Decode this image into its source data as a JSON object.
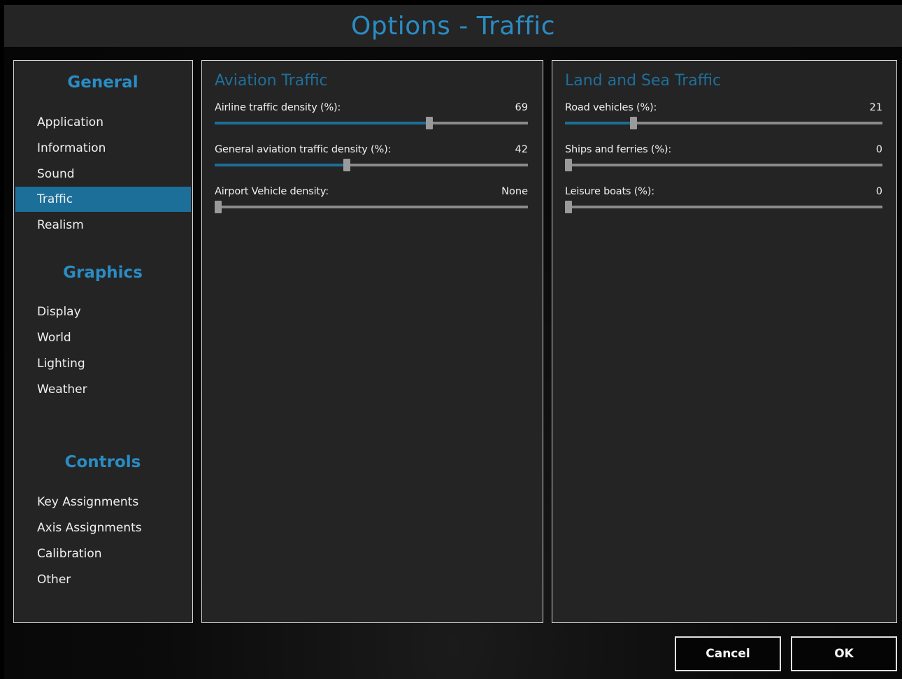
{
  "window": {
    "title": "Options - Traffic"
  },
  "sidebar": {
    "groups": [
      {
        "heading": "General",
        "items": [
          "Application",
          "Information",
          "Sound",
          "Traffic",
          "Realism"
        ]
      },
      {
        "heading": "Graphics",
        "items": [
          "Display",
          "World",
          "Lighting",
          "Weather"
        ]
      },
      {
        "heading": "Controls",
        "items": [
          "Key Assignments",
          "Axis Assignments",
          "Calibration",
          "Other"
        ]
      }
    ],
    "active_item": "Traffic"
  },
  "aviation": {
    "title": "Aviation Traffic",
    "settings": [
      {
        "label": "Airline traffic density (%):",
        "value": "69",
        "level": 0.69
      },
      {
        "label": "General aviation traffic density (%):",
        "value": "42",
        "level": 0.42
      },
      {
        "label": "Airport Vehicle density:",
        "value": "None",
        "level": 0
      }
    ]
  },
  "landsea": {
    "title": "Land and Sea Traffic",
    "settings": [
      {
        "label": "Road vehicles (%):",
        "value": "21",
        "level": 0.21
      },
      {
        "label": "Ships and ferries (%):",
        "value": "0",
        "level": 0
      },
      {
        "label": "Leisure boats (%):",
        "value": "0",
        "level": 0
      }
    ]
  },
  "buttons": {
    "cancel": "Cancel",
    "ok": "OK"
  },
  "colors": {
    "accent": "#2a8cc4",
    "active_bg": "#1c6f99",
    "panel_bg": "#242424",
    "title_bg": "#252525"
  }
}
